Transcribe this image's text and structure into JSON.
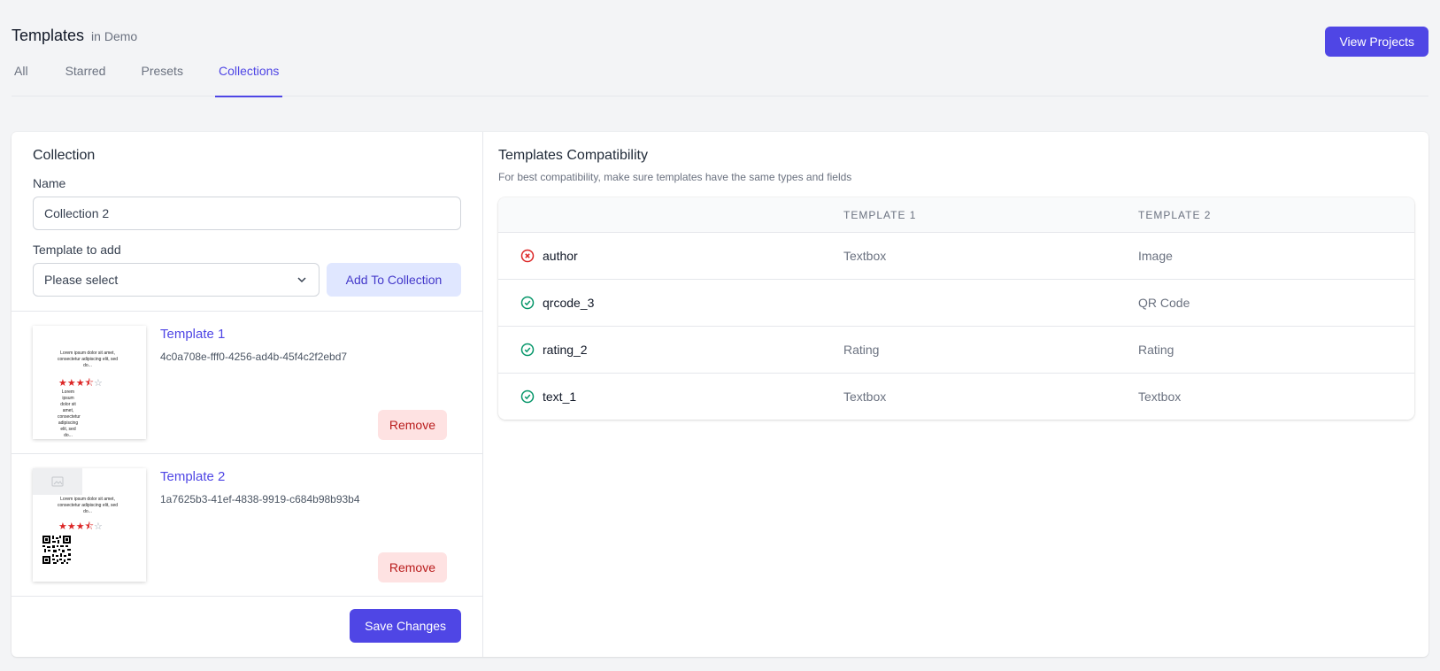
{
  "header": {
    "title": "Templates",
    "subtitle": "in Demo",
    "view_projects_label": "View Projects"
  },
  "tabs": [
    {
      "label": "All",
      "active": false
    },
    {
      "label": "Starred",
      "active": false
    },
    {
      "label": "Presets",
      "active": false
    },
    {
      "label": "Collections",
      "active": true
    }
  ],
  "collection": {
    "section_title": "Collection",
    "name_label": "Name",
    "name_value": "Collection 2",
    "template_label": "Template to add",
    "select_value": "Please select",
    "add_button": "Add To Collection",
    "save_button": "Save Changes",
    "remove_label": "Remove",
    "templates": [
      {
        "name": "Template 1",
        "id": "4c0a708e-fff0-4256-ad4b-45f4c2f2ebd7",
        "thumb_text": "Lorem ipsum dolor sit amet, consectetur adipiscing elit, sed do...",
        "thumb_text2": "Lorem ipsum dolor sit amet, consectetur adipiscing elit, sed do..."
      },
      {
        "name": "Template 2",
        "id": "1a7625b3-41ef-4838-9919-c684b98b93b4",
        "thumb_text": "Lorem ipsum dolor sit amet, consectetur adipiscing elit, sed do..."
      }
    ]
  },
  "compat": {
    "title": "Templates Compatibility",
    "subtitle": "For best compatibility, make sure templates have the same types and fields",
    "col_template1": "TEMPLATE 1",
    "col_template2": "TEMPLATE 2",
    "rows": [
      {
        "field": "author",
        "status": "error",
        "t1": "Textbox",
        "t2": "Image"
      },
      {
        "field": "qrcode_3",
        "status": "ok",
        "t1": "",
        "t2": "QR Code"
      },
      {
        "field": "rating_2",
        "status": "ok",
        "t1": "Rating",
        "t2": "Rating"
      },
      {
        "field": "text_1",
        "status": "ok",
        "t1": "Textbox",
        "t2": "Textbox"
      }
    ]
  },
  "colors": {
    "accent": "#4f46e5",
    "error": "#dc2626",
    "success": "#059669"
  }
}
